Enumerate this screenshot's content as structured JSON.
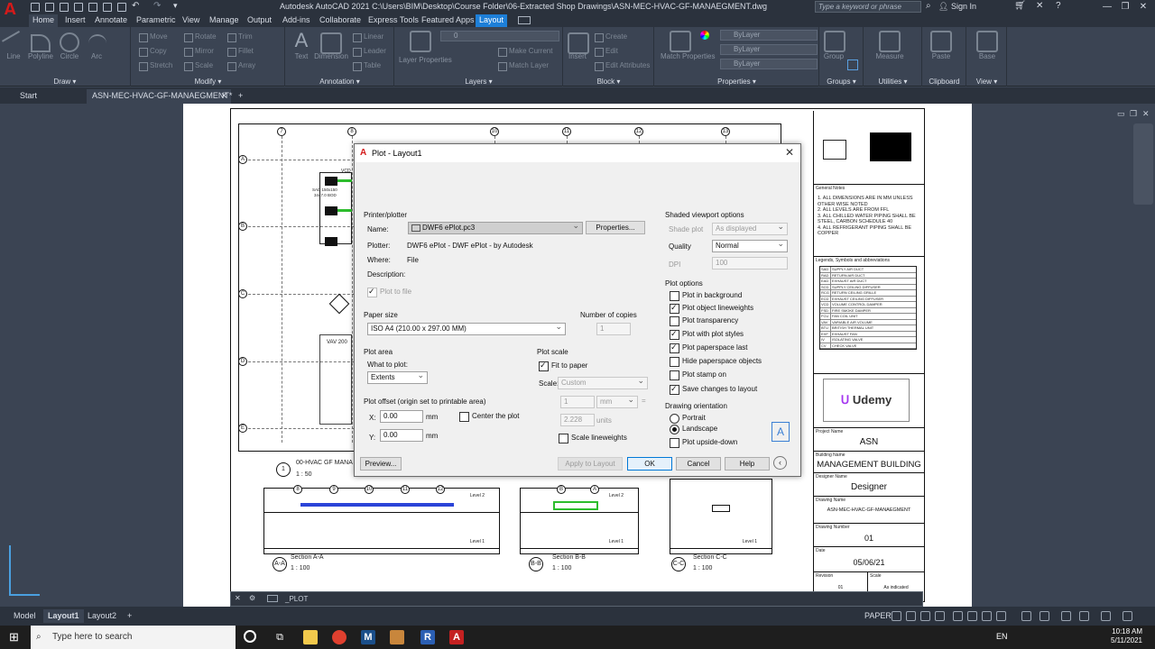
{
  "titlebar": {
    "title": "Autodesk AutoCAD 2021   C:\\Users\\BIM\\Desktop\\Course Folder\\06-Extracted Shop Drawings\\ASN-MEC-HVAC-GF-MANAEGMENT.dwg",
    "search_placeholder": "Type a keyword or phrase",
    "signin": "Sign In"
  },
  "ribbon_tabs": [
    "Home",
    "Insert",
    "Annotate",
    "Parametric",
    "View",
    "Manage",
    "Output",
    "Add-ins",
    "Collaborate",
    "Express Tools",
    "Featured Apps",
    "Layout"
  ],
  "ribbon": {
    "draw": {
      "title": "Draw",
      "tools": [
        "Line",
        "Polyline",
        "Circle",
        "Arc"
      ]
    },
    "modify": {
      "title": "Modify",
      "tools": [
        "Move",
        "Rotate",
        "Trim",
        "Copy",
        "Mirror",
        "Fillet",
        "Stretch",
        "Scale",
        "Array"
      ]
    },
    "annotation": {
      "title": "Annotation",
      "tools": [
        "Text",
        "Dimension",
        "Linear",
        "Leader",
        "Table"
      ]
    },
    "layers": {
      "title": "Layers",
      "tools": [
        "Layer Properties",
        "Make Current",
        "Match Layer"
      ]
    },
    "block": {
      "title": "Block",
      "tools": [
        "Insert",
        "Create",
        "Edit",
        "Edit Attributes"
      ]
    },
    "properties": {
      "title": "Properties",
      "tools": [
        "Match Properties"
      ],
      "bylayer": [
        "ByLayer",
        "ByLayer",
        "ByLayer"
      ]
    },
    "groups": {
      "title": "Groups",
      "tools": [
        "Group"
      ]
    },
    "utilities": {
      "title": "Utilities",
      "tools": [
        "Measure"
      ]
    },
    "clipboard": {
      "title": "Clipboard",
      "tools": [
        "Paste"
      ]
    },
    "view": {
      "title": "View",
      "tools": [
        "Base"
      ]
    }
  },
  "doc_tabs": [
    "Start",
    "ASN-MEC-HVAC-GF-MANAEGMENT*"
  ],
  "drawing": {
    "grid_top": [
      "7",
      "8",
      "10",
      "11",
      "12",
      "13"
    ],
    "grid_left": [
      "A",
      "B",
      "C",
      "D",
      "E"
    ],
    "plan_title": "00-HVAC GF MANA",
    "plan_scale": "1 : 50",
    "plan_number": "1",
    "sections": [
      {
        "tag": "A-A",
        "title": "Section A-A",
        "scale": "1 : 100",
        "bubbles": [
          "8",
          "9",
          "10",
          "11",
          "12"
        ]
      },
      {
        "tag": "B-B",
        "title": "Section B-B",
        "scale": "1 : 100",
        "bubbles": [
          "B",
          "A"
        ]
      },
      {
        "tag": "C-C",
        "title": "Section C-C",
        "scale": "1 : 100",
        "bubbles": []
      }
    ],
    "level_labels": [
      "Level 2",
      "Level 1"
    ],
    "plan_notes": [
      "VCD",
      "SAD 150x150",
      "3447.0 BOD",
      "VAV 200"
    ]
  },
  "titleblock": {
    "general_notes_label": "General Notes",
    "general_notes": [
      "1.  ALL DIMENSIONS ARE IN MM UNLESS OTHER WISE NOTED",
      "2.  ALL LEVELS ARE FROM FFL",
      "3.  ALL CHILLED WATER PIPING SHALL BE STEEL, CARBON SCHEDULE 40",
      "4.  ALL REFRIGERANT PIPING SHALL BE COPPER"
    ],
    "legend_label": "Legends, Symbols and abbreviations",
    "legend": [
      [
        "SAD",
        "SUPPLY AIR DUCT"
      ],
      [
        "RAD",
        "RETURN AIR DUCT"
      ],
      [
        "EAD",
        "EXHAUST AIR DUCT"
      ],
      [
        "SCD",
        "SUPPLY CEILING DIFFUSER"
      ],
      [
        "RCG",
        "RETURN CEILING GRILLE"
      ],
      [
        "ECD",
        "EXHAUST CEILING DIFFUSER"
      ],
      [
        "VCD",
        "VOLUME CONTROL DAMPER"
      ],
      [
        "FSD",
        "FIRE SMOKE DAMPER"
      ],
      [
        "FCU",
        "FAN COIL UNIT"
      ],
      [
        "VAV",
        "VARIABLE AIR VOLUME"
      ],
      [
        "BTU",
        "BRITISH THERMAL UNIT"
      ],
      [
        "EXF",
        "EXHAUST FAN"
      ],
      [
        "IV",
        "ISOLATING VALVE"
      ],
      [
        "CV",
        "CHECK VALVE"
      ]
    ],
    "logo": "Udemy",
    "project_name_label": "Project Name",
    "project_name": "ASN",
    "building_name_label": "Building Name",
    "building_name": "MANAGEMENT BUILDING",
    "designer_name_label": "Designer Name",
    "designer_name": "Designer",
    "drawing_name_label": "Drawing Name",
    "drawing_name": "ASN-MEC-HVAC-GF-MANAEGMENT",
    "drawing_number_label": "Drawing Number",
    "drawing_number": "01",
    "date_label": "Date",
    "date": "05/06/21",
    "revision_label": "Revision",
    "revision": "01",
    "scale_label": "Scale",
    "scale": "As indicated"
  },
  "dialog": {
    "title": "Plot - Layout1",
    "printer_group": "Printer/plotter",
    "name_label": "Name:",
    "name_value": "DWF6 ePlot.pc3",
    "properties_button": "Properties...",
    "plotter_label": "Plotter:",
    "plotter_value": "DWF6 ePlot - DWF ePlot - by Autodesk",
    "where_label": "Where:",
    "where_value": "File",
    "description_label": "Description:",
    "plot_to_file": "Plot to file",
    "paper_size_group": "Paper size",
    "paper_size_value": "ISO A4 (210.00 x 297.00 MM)",
    "copies_label": "Number of copies",
    "copies_value": "1",
    "plot_area_group": "Plot area",
    "what_to_plot_label": "What to plot:",
    "what_to_plot_value": "Extents",
    "plot_scale_group": "Plot scale",
    "fit_to_paper": "Fit to paper",
    "scale_label": "Scale:",
    "scale_value": "Custom",
    "scale_num": "1",
    "scale_unit": "mm",
    "scale_den": "2.228",
    "scale_den_unit": "units",
    "scale_lineweights": "Scale lineweights",
    "offset_group": "Plot offset (origin set to printable area)",
    "x_label": "X:",
    "x_value": "0.00",
    "y_label": "Y:",
    "y_value": "0.00",
    "offset_unit": "mm",
    "center_the_plot": "Center the plot",
    "preview_button": "Preview...",
    "apply_button": "Apply to Layout",
    "ok_button": "OK",
    "cancel_button": "Cancel",
    "help_button": "Help",
    "shaded_group": "Shaded viewport options",
    "shade_plot_label": "Shade plot",
    "shade_plot_value": "As displayed",
    "quality_label": "Quality",
    "quality_value": "Normal",
    "dpi_label": "DPI",
    "dpi_value": "100",
    "plot_options_group": "Plot options",
    "options": [
      {
        "label": "Plot in background",
        "checked": false
      },
      {
        "label": "Plot object lineweights",
        "checked": true
      },
      {
        "label": "Plot transparency",
        "checked": false
      },
      {
        "label": "Plot with plot styles",
        "checked": true
      },
      {
        "label": "Plot paperspace last",
        "checked": true
      },
      {
        "label": "Hide paperspace objects",
        "checked": false
      },
      {
        "label": "Plot stamp on",
        "checked": false
      },
      {
        "label": "Save changes to layout",
        "checked": true
      }
    ],
    "orientation_group": "Drawing orientation",
    "portrait": "Portrait",
    "landscape": "Landscape",
    "upside_down": "Plot upside-down"
  },
  "cmdline": {
    "text": "_PLOT"
  },
  "layout_tabs": [
    "Model",
    "Layout1",
    "Layout2"
  ],
  "status": {
    "paper": "PAPER"
  },
  "taskbar": {
    "search_placeholder": "Type here to search",
    "lang": "EN",
    "time": "10:18 AM",
    "date": "5/11/2021"
  }
}
